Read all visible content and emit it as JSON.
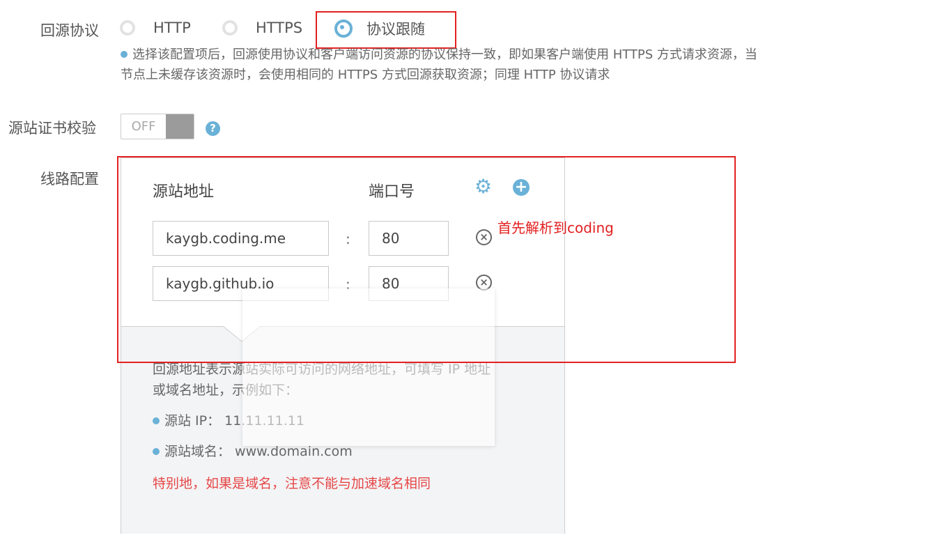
{
  "origin_protocol": {
    "label": "回源协议",
    "options": [
      {
        "label": "HTTP",
        "checked": false
      },
      {
        "label": "HTTPS",
        "checked": false
      },
      {
        "label": "协议跟随",
        "checked": true
      }
    ],
    "hint_line1": "选择该配置项后，回源使用协议和客户端访问资源的协议保持一致，即如果客户端使用 HTTPS 方式请求资源，当",
    "hint_line2": "节点上未缓存该资源时，会使用相同的 HTTPS 方式回源获取资源；同理 HTTP 协议请求"
  },
  "cert_check": {
    "label": "源站证书校验",
    "toggle_text": "OFF",
    "help_glyph": "?"
  },
  "line_config": {
    "label": "线路配置",
    "headers": {
      "address": "源站地址",
      "port": "端口号"
    },
    "rows": [
      {
        "address": "kaygb.coding.me",
        "separator": ":",
        "port": "80"
      },
      {
        "address": "kaygb.github.io",
        "separator": ":",
        "port": "80"
      }
    ],
    "info": {
      "line1": "回源地址表示源站实际可访问的网络地址，可填写 IP 地址",
      "line2": "或域名地址，示例如下：",
      "ip_example": "源站 IP： 11.11.11.11",
      "domain_example": "源站域名： www.domain.com",
      "warning": "特别地，如果是域名，注意不能与加速域名相同"
    }
  },
  "annotation": {
    "text": "首先解析到coding"
  },
  "icons": {
    "settings": "gear-icon",
    "add": "plus-circle-icon",
    "remove": "close-circle-icon"
  },
  "colors": {
    "accent": "#6ab1d7",
    "annotation_red": "#e32020",
    "warning_red": "#e64747"
  }
}
